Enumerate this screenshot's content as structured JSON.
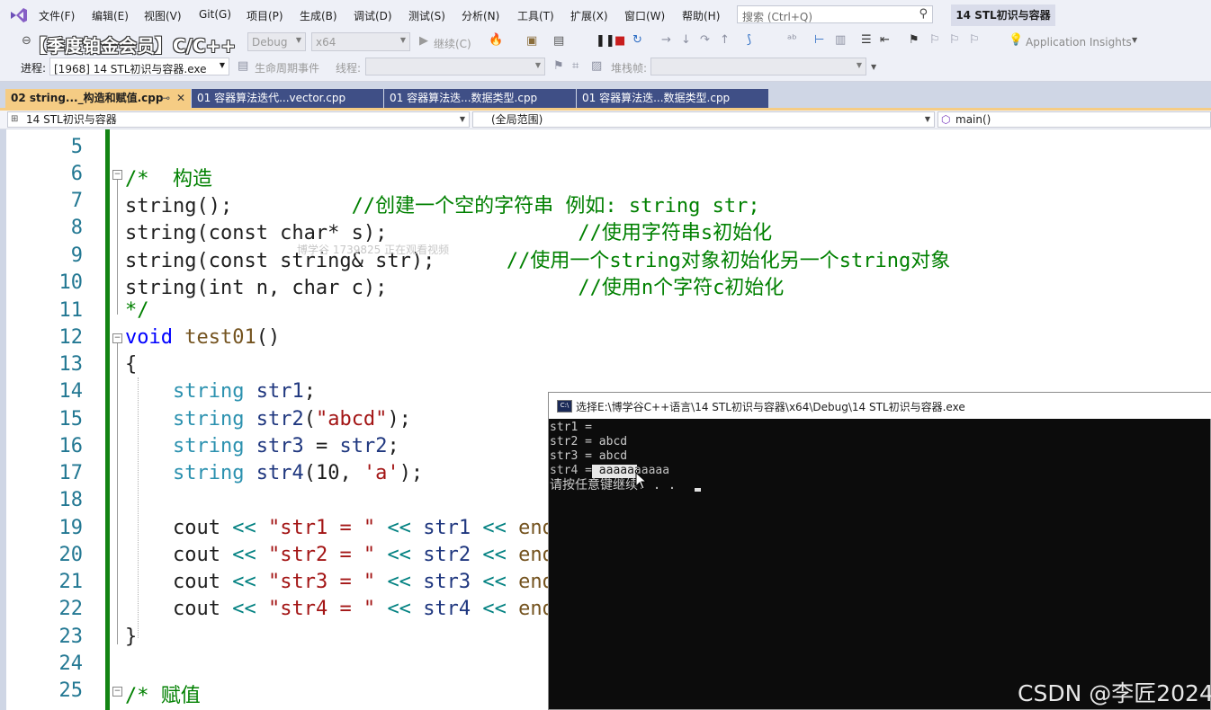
{
  "menubar": {
    "items": [
      "文件(F)",
      "编辑(E)",
      "视图(V)",
      "Git(G)",
      "项目(P)",
      "生成(B)",
      "调试(D)",
      "测试(S)",
      "分析(N)",
      "工具(T)",
      "扩展(X)",
      "窗口(W)",
      "帮助(H)"
    ],
    "search_placeholder": "搜索 (Ctrl+Q)",
    "solution_name": "14 STL初识与容器"
  },
  "promo_banner": "【季度铂金会员】C/C++",
  "toolbar1": {
    "config": "Debug",
    "platform": "x64",
    "continue_label": "继续(C)",
    "app_insights": "Application Insights"
  },
  "toolbar2": {
    "process_label": "进程:",
    "process_value": "[1968] 14 STL初识与容器.exe",
    "lifecycle_label": "生命周期事件",
    "thread_label": "线程:",
    "stackframe_label": "堆栈帧:"
  },
  "tabs": [
    {
      "label": "02 string..._构造和赋值.cpp",
      "active": true
    },
    {
      "label": "01 容器算法迭代...vector.cpp",
      "active": false
    },
    {
      "label": "01 容器算法迭...数据类型.cpp",
      "active": false
    },
    {
      "label": "01 容器算法迭...数据类型.cpp",
      "active": false
    }
  ],
  "navbar": {
    "project": "14 STL初识与容器",
    "scope": "(全局范围)",
    "member": "main()"
  },
  "editor": {
    "line_numbers": [
      "5",
      "6",
      "7",
      "8",
      "9",
      "10",
      "11",
      "12",
      "13",
      "14",
      "15",
      "16",
      "17",
      "18",
      "19",
      "20",
      "21",
      "22",
      "23",
      "24",
      "25"
    ],
    "watermark": "博学谷 1739825 正在观看视频"
  },
  "console": {
    "title": "选择E:\\博学谷C++语言\\14 STL初识与容器\\x64\\Debug\\14 STL初识与容器.exe",
    "lines": [
      "str1 = ",
      "str2 = abcd",
      "str3 = abcd",
      "str4 = aaaaaaaaaa",
      "请按任意键继续. . . "
    ]
  },
  "overlay": {
    "csdn": "CSDN @李匠2024"
  },
  "colors": {
    "menu_bg": "#eef0f7",
    "tab_active": "#f5cc84",
    "tab_inactive": "#3f4f86",
    "change_bar": "#138413",
    "comment": "#008000",
    "keyword": "#0000ff",
    "type": "#2b91af",
    "string": "#a31515",
    "console_bg": "#0c0c0c"
  }
}
